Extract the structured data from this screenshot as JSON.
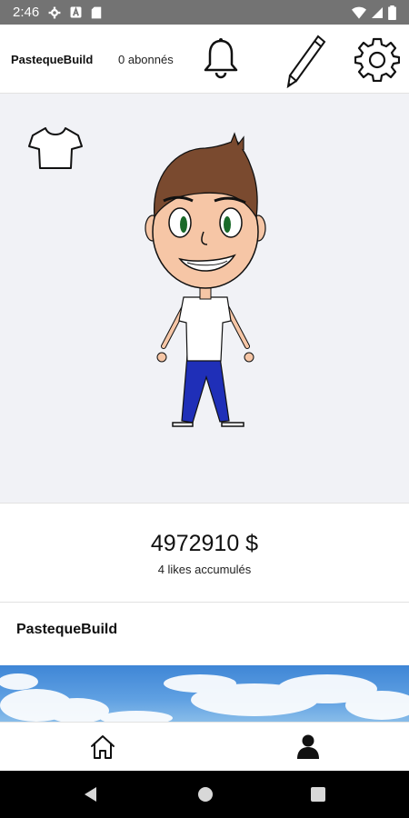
{
  "status_bar": {
    "time": "2:46",
    "icons": [
      "gear-icon",
      "a-icon",
      "sd-card-icon",
      "wifi-icon",
      "signal-icon",
      "battery-icon"
    ]
  },
  "header": {
    "username": "PastequeBuild",
    "followers": "0 abonnés",
    "icons": [
      "bell-icon",
      "pencil-icon",
      "gear-icon"
    ]
  },
  "avatar": {
    "wardrobe_icon": "tshirt-icon",
    "colors": {
      "hair": "#7a4a2f",
      "skin": "#f6c6a6",
      "shirt": "#ffffff",
      "pants": "#1f2fb8",
      "eyes": "#1a6a2a"
    }
  },
  "stats": {
    "money": "4972910 $",
    "likes": "4 likes accumulés"
  },
  "profile": {
    "name": "PastequeBuild"
  },
  "bottom_nav": {
    "items": [
      "home-icon",
      "profile-icon"
    ]
  },
  "system_nav": {
    "items": [
      "back-icon",
      "home-circle-icon",
      "recent-apps-icon"
    ]
  }
}
